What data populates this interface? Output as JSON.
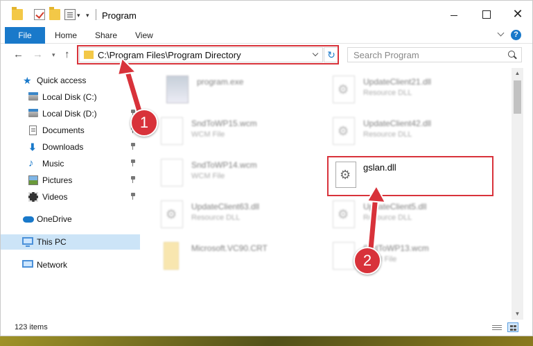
{
  "window": {
    "title": "Program"
  },
  "ribbon": {
    "file": "File",
    "tabs": [
      "Home",
      "Share",
      "View"
    ],
    "help": "?"
  },
  "nav": {
    "address": "C:\\Program Files\\Program Directory",
    "search_placeholder": "Search Program"
  },
  "sidebar": {
    "items": [
      {
        "label": "Quick access",
        "icon": "star-icon",
        "pinned": false
      },
      {
        "label": "Local Disk (C:)",
        "icon": "drive-icon",
        "pinned": true
      },
      {
        "label": "Local Disk (D:)",
        "icon": "drive-icon",
        "pinned": true
      },
      {
        "label": "Documents",
        "icon": "documents-icon",
        "pinned": true
      },
      {
        "label": "Downloads",
        "icon": "downloads-icon",
        "pinned": true
      },
      {
        "label": "Music",
        "icon": "music-icon",
        "pinned": true
      },
      {
        "label": "Pictures",
        "icon": "pictures-icon",
        "pinned": true
      },
      {
        "label": "Videos",
        "icon": "videos-icon",
        "pinned": true
      },
      {
        "label": "OneDrive",
        "icon": "cloud-icon",
        "pinned": false
      },
      {
        "label": "This PC",
        "icon": "computer-icon",
        "pinned": false
      },
      {
        "label": "Network",
        "icon": "network-icon",
        "pinned": false
      }
    ]
  },
  "files": [
    {
      "name": "program.exe",
      "type": ""
    },
    {
      "name": "UpdateClient21.dll",
      "type": "Resource DLL"
    },
    {
      "name": "SndToWP15.wcm",
      "type": "WCM File"
    },
    {
      "name": "UpdateClient42.dll",
      "type": "Resource DLL"
    },
    {
      "name": "SndToWP14.wcm",
      "type": "WCM File"
    },
    {
      "name": "UpdateClient63.dll",
      "type": "Resource DLL"
    },
    {
      "name": "UpdateClient5.dll",
      "type": "Resource DLL"
    },
    {
      "name": "Microsoft.VC90.CRT",
      "type": ""
    },
    {
      "name": "SndToWP13.wcm",
      "type": "WCM File"
    }
  ],
  "highlighted_file": {
    "name": "gslan.dll"
  },
  "status": {
    "items": "123 items"
  },
  "annotations": {
    "step1": "1",
    "step2": "2",
    "color": "#d8323a"
  }
}
